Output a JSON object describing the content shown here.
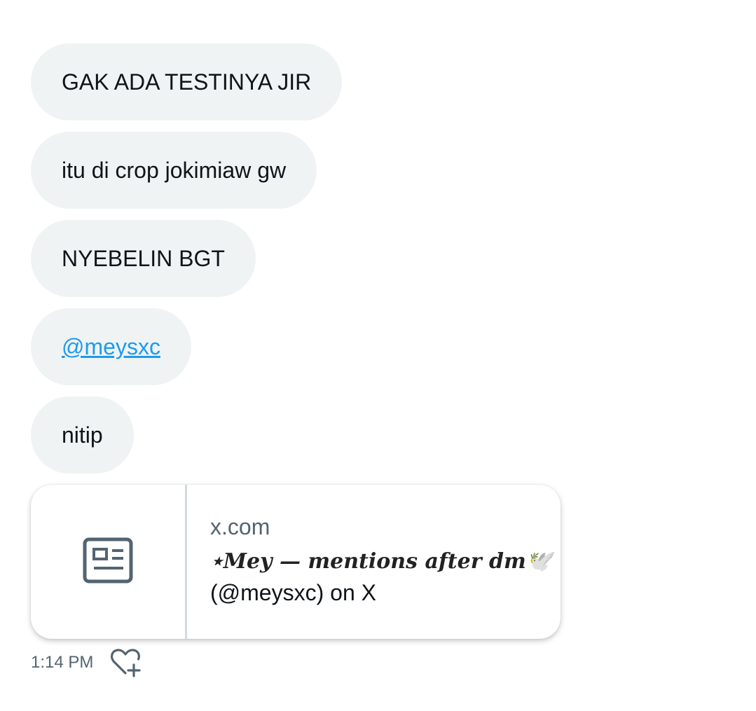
{
  "messages": [
    {
      "text": "GAK ADA TESTINYA JIR"
    },
    {
      "text": "itu di crop jokimiaw gw"
    },
    {
      "text": "NYEBELIN BGT"
    },
    {
      "text": "@meysxc"
    },
    {
      "text": "nitip"
    }
  ],
  "link_card": {
    "domain": "x.com",
    "title_styled": "⋆Mey — mentions after dm🕊️",
    "title_plain": "(@meysxc) on X",
    "thumbnail_icon": "article-icon"
  },
  "meta": {
    "timestamp": "1:14 PM",
    "react_icon": "heart-plus-icon"
  },
  "colors": {
    "bubble_bg": "#eff3f4",
    "mention": "#1d9bf0",
    "muted_text": "#536471",
    "text": "#0f1419"
  }
}
